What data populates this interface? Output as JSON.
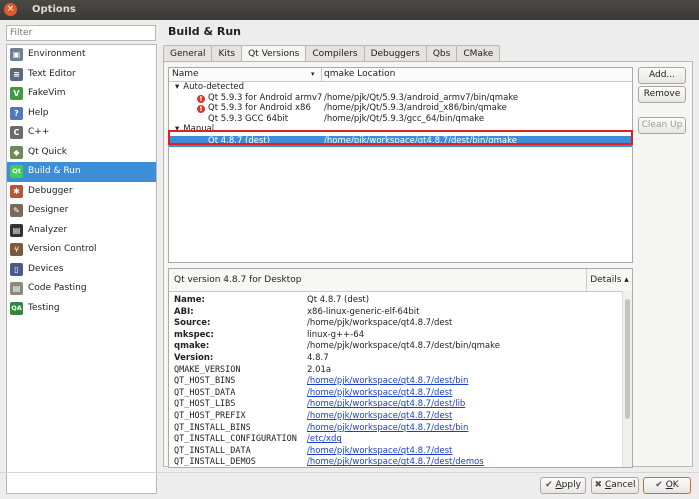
{
  "window": {
    "title": "Options",
    "close_glyph": "×"
  },
  "filter": {
    "placeholder": "Filter"
  },
  "sidebar": {
    "items": [
      {
        "label": "Environment",
        "icon": "monitor-icon",
        "color": "#6d7f93",
        "glyph": "▣"
      },
      {
        "label": "Text Editor",
        "icon": "text-editor-icon",
        "color": "#5a6b7c",
        "glyph": "≡"
      },
      {
        "label": "FakeVim",
        "icon": "fakevim-icon",
        "color": "#3f9b3f",
        "glyph": "V"
      },
      {
        "label": "Help",
        "icon": "help-icon",
        "color": "#4f79b8",
        "glyph": "?"
      },
      {
        "label": "C++",
        "icon": "cpp-icon",
        "color": "#6b6b6b",
        "glyph": "C"
      },
      {
        "label": "Qt Quick",
        "icon": "qt-quick-icon",
        "color": "#6c8a5a",
        "glyph": "◆"
      },
      {
        "label": "Build & Run",
        "icon": "build-run-icon",
        "color": "#41cd52",
        "glyph": "Qt"
      },
      {
        "label": "Debugger",
        "icon": "debugger-icon",
        "color": "#b5553a",
        "glyph": "✱"
      },
      {
        "label": "Designer",
        "icon": "designer-icon",
        "color": "#7a6a5a",
        "glyph": "✎"
      },
      {
        "label": "Analyzer",
        "icon": "analyzer-icon",
        "color": "#333333",
        "glyph": "▤"
      },
      {
        "label": "Version Control",
        "icon": "version-control-icon",
        "color": "#7a5a3a",
        "glyph": "⑂"
      },
      {
        "label": "Devices",
        "icon": "devices-icon",
        "color": "#4a5a8a",
        "glyph": "▯"
      },
      {
        "label": "Code Pasting",
        "icon": "code-pasting-icon",
        "color": "#8a8a7a",
        "glyph": "▤"
      },
      {
        "label": "Testing",
        "icon": "testing-icon",
        "color": "#2d8a3a",
        "glyph": "QA"
      }
    ],
    "selected_index": 6
  },
  "header": {
    "title": "Build & Run"
  },
  "tabs": [
    {
      "label": "General",
      "active": false
    },
    {
      "label": "Kits",
      "active": false
    },
    {
      "label": "Qt Versions",
      "active": true
    },
    {
      "label": "Compilers",
      "active": false
    },
    {
      "label": "Debuggers",
      "active": false
    },
    {
      "label": "Qbs",
      "active": false
    },
    {
      "label": "CMake",
      "active": false
    }
  ],
  "tree": {
    "col_name": "Name",
    "col_location": "qmake Location",
    "rows": [
      {
        "name": "Auto-detected",
        "location": "",
        "indent": 6,
        "arrow": "▾",
        "error": false,
        "selected": false
      },
      {
        "name": "Qt 5.9.3 for Android armv7",
        "location": "/home/pjk/Qt/5.9.3/android_armv7/bin/qmake",
        "indent": 28,
        "arrow": "",
        "error": true,
        "selected": false
      },
      {
        "name": "Qt 5.9.3 for Android x86",
        "location": "/home/pjk/Qt/5.9.3/android_x86/bin/qmake",
        "indent": 28,
        "arrow": "",
        "error": true,
        "selected": false
      },
      {
        "name": "Qt 5.9.3 GCC 64bit",
        "location": "/home/pjk/Qt/5.9.3/gcc_64/bin/qmake",
        "indent": 28,
        "arrow": "",
        "error": false,
        "selected": false
      },
      {
        "name": "Manual",
        "location": "",
        "indent": 6,
        "arrow": "▾",
        "error": false,
        "selected": false
      },
      {
        "name": "Qt 4.8.7 (dest)",
        "location": "/home/pjk/workspace/qt4.8.7/dest/bin/qmake",
        "indent": 28,
        "arrow": "",
        "error": false,
        "selected": true
      }
    ]
  },
  "side_buttons": {
    "add": "Add...",
    "remove": "Remove",
    "clean_up": "Clean Up"
  },
  "details": {
    "title": "Qt version 4.8.7 for Desktop",
    "toggle_label": "Details",
    "toggle_glyph": "▴",
    "rows": [
      {
        "key": "Name:",
        "value": "Qt 4.8.7 (dest)",
        "style": "b",
        "link": false
      },
      {
        "key": "ABI:",
        "value": "x86-linux-generic-elf-64bit",
        "style": "b",
        "link": false
      },
      {
        "key": "Source:",
        "value": "/home/pjk/workspace/qt4.8.7/dest",
        "style": "b",
        "link": false
      },
      {
        "key": "mkspec:",
        "value": "linux-g++-64",
        "style": "b",
        "link": false
      },
      {
        "key": "qmake:",
        "value": "/home/pjk/workspace/qt4.8.7/dest/bin/qmake",
        "style": "b",
        "link": false
      },
      {
        "key": "Version:",
        "value": "4.8.7",
        "style": "b",
        "link": false
      },
      {
        "key": "QMAKE_VERSION",
        "value": "2.01a",
        "style": "m",
        "link": false
      },
      {
        "key": "QT_HOST_BINS",
        "value": "/home/pjk/workspace/qt4.8.7/dest/bin",
        "style": "m",
        "link": true
      },
      {
        "key": "QT_HOST_DATA",
        "value": "/home/pjk/workspace/qt4.8.7/dest",
        "style": "m",
        "link": true
      },
      {
        "key": "QT_HOST_LIBS",
        "value": "/home/pjk/workspace/qt4.8.7/dest/lib",
        "style": "m",
        "link": true
      },
      {
        "key": "QT_HOST_PREFIX",
        "value": "/home/pjk/workspace/qt4.8.7/dest",
        "style": "m",
        "link": true
      },
      {
        "key": "QT_INSTALL_BINS",
        "value": "/home/pjk/workspace/qt4.8.7/dest/bin",
        "style": "m",
        "link": true
      },
      {
        "key": "QT_INSTALL_CONFIGURATION",
        "value": "/etc/xdg",
        "style": "m",
        "link": true
      },
      {
        "key": "QT_INSTALL_DATA",
        "value": "/home/pjk/workspace/qt4.8.7/dest",
        "style": "m",
        "link": true
      },
      {
        "key": "QT_INSTALL_DEMOS",
        "value": "/home/pjk/workspace/qt4.8.7/dest/demos",
        "style": "m",
        "link": true
      }
    ]
  },
  "footer": {
    "apply": {
      "mnemonic": "A",
      "rest": "pply",
      "icon_glyph": "✔"
    },
    "cancel": {
      "mnemonic": "C",
      "rest": "ancel",
      "icon_glyph": "✖"
    },
    "ok": {
      "mnemonic": "O",
      "rest": "K",
      "icon_glyph": "✔"
    }
  }
}
